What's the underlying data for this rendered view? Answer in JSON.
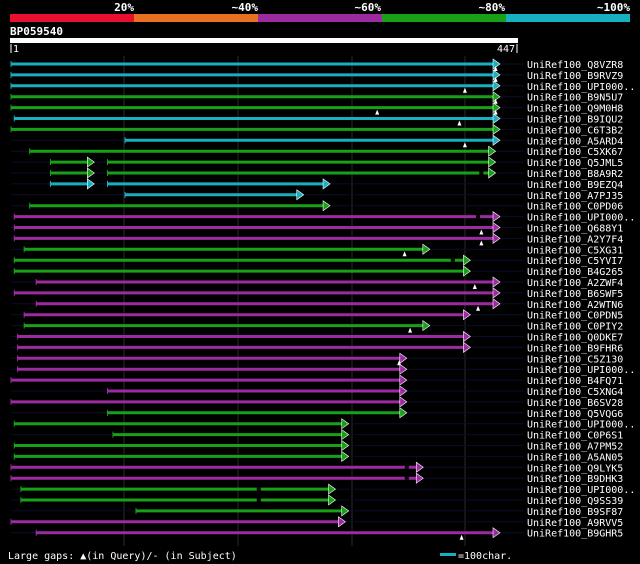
{
  "header": {
    "scale_labels": [
      "20%",
      "~40%",
      "~60%",
      "~80%",
      "~100%"
    ],
    "scale_colors": [
      "#e8102c",
      "#e87020",
      "#9c2aa0",
      "#18a018",
      "#18b0c0"
    ],
    "query_name": "BP059540",
    "ruler_start": "1",
    "ruler_end": "447"
  },
  "footer": {
    "gaps_label": "Large gaps: ▲(in Query)/- (in Subject)",
    "legend_label": "=100char.",
    "legend_color": "#18b0c0"
  },
  "query_length": 447,
  "hits": [
    {
      "name": "UniRef100_Q8VZR8",
      "color": "#18b0c0",
      "segments": [
        [
          1,
          447
        ]
      ],
      "gapsQ": [
        443
      ],
      "gapsS": []
    },
    {
      "name": "UniRef100_B9RVZ9",
      "color": "#18b0c0",
      "segments": [
        [
          1,
          447
        ]
      ],
      "gapsQ": [
        443
      ],
      "gapsS": []
    },
    {
      "name": "UniRef100_UPI000..",
      "color": "#18b0c0",
      "segments": [
        [
          1,
          447
        ]
      ],
      "gapsQ": [
        415
      ],
      "gapsS": []
    },
    {
      "name": "UniRef100_B9N5U7",
      "color": "#18a018",
      "segments": [
        [
          1,
          447
        ]
      ],
      "gapsQ": [
        443
      ],
      "gapsS": []
    },
    {
      "name": "UniRef100_Q9M0H8",
      "color": "#18a018",
      "segments": [
        [
          1,
          447
        ]
      ],
      "gapsQ": [
        335,
        443
      ],
      "gapsS": []
    },
    {
      "name": "UniRef100_B9IQU2",
      "color": "#18b0c0",
      "segments": [
        [
          4,
          447
        ]
      ],
      "gapsQ": [
        410
      ],
      "gapsS": []
    },
    {
      "name": "UniRef100_C6T3B2",
      "color": "#18a018",
      "segments": [
        [
          1,
          447
        ]
      ],
      "gapsQ": [],
      "gapsS": []
    },
    {
      "name": "UniRef100_A5ARD4",
      "color": "#18b0c0",
      "segments": [
        [
          105,
          447
        ]
      ],
      "gapsQ": [
        415
      ],
      "gapsS": []
    },
    {
      "name": "UniRef100_C5XK67",
      "color": "#18a018",
      "segments": [
        [
          18,
          443
        ]
      ],
      "gapsQ": [],
      "gapsS": []
    },
    {
      "name": "UniRef100_Q5JML5",
      "color": "#18a018",
      "segments": [
        [
          37,
          77
        ],
        [
          89,
          443
        ]
      ],
      "gapsQ": [],
      "gapsS": []
    },
    {
      "name": "UniRef100_B8A9R2",
      "color": "#18a018",
      "segments": [
        [
          37,
          77
        ],
        [
          89,
          443
        ]
      ],
      "gapsQ": [],
      "gapsS": [
        430
      ]
    },
    {
      "name": "UniRef100_B9EZQ4",
      "color": "#18b0c0",
      "segments": [
        [
          37,
          77
        ],
        [
          89,
          292
        ]
      ],
      "gapsQ": [],
      "gapsS": []
    },
    {
      "name": "UniRef100_A7PJ35",
      "color": "#18b0c0",
      "segments": [
        [
          105,
          268
        ]
      ],
      "gapsQ": [],
      "gapsS": []
    },
    {
      "name": "UniRef100_C0PD06",
      "color": "#18a018",
      "segments": [
        [
          18,
          292
        ]
      ],
      "gapsQ": [],
      "gapsS": []
    },
    {
      "name": "UniRef100_UPI000..",
      "color": "#9c2aa0",
      "segments": [
        [
          4,
          447
        ]
      ],
      "gapsQ": [],
      "gapsS": [
        427
      ]
    },
    {
      "name": "UniRef100_Q688Y1",
      "color": "#9c2aa0",
      "segments": [
        [
          4,
          447
        ]
      ],
      "gapsQ": [
        430
      ],
      "gapsS": []
    },
    {
      "name": "UniRef100_A2Y7F4",
      "color": "#9c2aa0",
      "segments": [
        [
          4,
          447
        ]
      ],
      "gapsQ": [
        430
      ],
      "gapsS": []
    },
    {
      "name": "UniRef100_C5XG31",
      "color": "#18a018",
      "segments": [
        [
          13,
          383
        ]
      ],
      "gapsQ": [
        360
      ],
      "gapsS": []
    },
    {
      "name": "UniRef100_C5YVI7",
      "color": "#18a018",
      "segments": [
        [
          4,
          420
        ]
      ],
      "gapsQ": [],
      "gapsS": [
        404
      ]
    },
    {
      "name": "UniRef100_B4G265",
      "color": "#18a018",
      "segments": [
        [
          4,
          420
        ]
      ],
      "gapsQ": [],
      "gapsS": []
    },
    {
      "name": "UniRef100_A2ZWF4",
      "color": "#9c2aa0",
      "segments": [
        [
          24,
          447
        ]
      ],
      "gapsQ": [
        424
      ],
      "gapsS": []
    },
    {
      "name": "UniRef100_B6SWF5",
      "color": "#9c2aa0",
      "segments": [
        [
          4,
          447
        ]
      ],
      "gapsQ": [],
      "gapsS": []
    },
    {
      "name": "UniRef100_A2WTN6",
      "color": "#9c2aa0",
      "segments": [
        [
          24,
          447
        ]
      ],
      "gapsQ": [
        427
      ],
      "gapsS": []
    },
    {
      "name": "UniRef100_C0PDN5",
      "color": "#9c2aa0",
      "segments": [
        [
          13,
          420
        ]
      ],
      "gapsQ": [],
      "gapsS": []
    },
    {
      "name": "UniRef100_C0PIY2",
      "color": "#18a018",
      "segments": [
        [
          13,
          383
        ]
      ],
      "gapsQ": [
        365
      ],
      "gapsS": []
    },
    {
      "name": "UniRef100_Q0DKE7",
      "color": "#9c2aa0",
      "segments": [
        [
          7,
          420
        ]
      ],
      "gapsQ": [],
      "gapsS": []
    },
    {
      "name": "UniRef100_B9FHR6",
      "color": "#9c2aa0",
      "segments": [
        [
          7,
          420
        ]
      ],
      "gapsQ": [],
      "gapsS": []
    },
    {
      "name": "UniRef100_C5Z130",
      "color": "#9c2aa0",
      "segments": [
        [
          7,
          362
        ]
      ],
      "gapsQ": [
        355
      ],
      "gapsS": []
    },
    {
      "name": "UniRef100_UPI000..",
      "color": "#9c2aa0",
      "segments": [
        [
          7,
          362
        ]
      ],
      "gapsQ": [],
      "gapsS": []
    },
    {
      "name": "UniRef100_B4FQ71",
      "color": "#9c2aa0",
      "segments": [
        [
          1,
          362
        ]
      ],
      "gapsQ": [],
      "gapsS": []
    },
    {
      "name": "UniRef100_C5XNG4",
      "color": "#9c2aa0",
      "segments": [
        [
          89,
          362
        ]
      ],
      "gapsQ": [],
      "gapsS": []
    },
    {
      "name": "UniRef100_B6SV28",
      "color": "#9c2aa0",
      "segments": [
        [
          1,
          362
        ]
      ],
      "gapsQ": [],
      "gapsS": []
    },
    {
      "name": "UniRef100_Q5VQG6",
      "color": "#18a018",
      "segments": [
        [
          89,
          362
        ]
      ],
      "gapsQ": [],
      "gapsS": []
    },
    {
      "name": "UniRef100_UPI000..",
      "color": "#18a018",
      "segments": [
        [
          4,
          309
        ]
      ],
      "gapsQ": [],
      "gapsS": []
    },
    {
      "name": "UniRef100_C0P6S1",
      "color": "#18a018",
      "segments": [
        [
          94,
          309
        ]
      ],
      "gapsQ": [],
      "gapsS": []
    },
    {
      "name": "UniRef100_A7PM52",
      "color": "#18a018",
      "segments": [
        [
          4,
          309
        ]
      ],
      "gapsQ": [],
      "gapsS": []
    },
    {
      "name": "UniRef100_A5AN05",
      "color": "#18a018",
      "segments": [
        [
          4,
          309
        ]
      ],
      "gapsQ": [],
      "gapsS": []
    },
    {
      "name": "UniRef100_Q9LYK5",
      "color": "#9c2aa0",
      "segments": [
        [
          1,
          377
        ]
      ],
      "gapsQ": [],
      "gapsS": [
        362
      ]
    },
    {
      "name": "UniRef100_B9DHK3",
      "color": "#9c2aa0",
      "segments": [
        [
          1,
          377
        ]
      ],
      "gapsQ": [],
      "gapsS": [
        362
      ]
    },
    {
      "name": "UniRef100_UPI000..",
      "color": "#18a018",
      "segments": [
        [
          10,
          297
        ]
      ],
      "gapsQ": [],
      "gapsS": [
        227
      ]
    },
    {
      "name": "UniRef100_Q9SS39",
      "color": "#18a018",
      "segments": [
        [
          10,
          297
        ]
      ],
      "gapsQ": [],
      "gapsS": [
        227
      ]
    },
    {
      "name": "UniRef100_B9SF87",
      "color": "#18a018",
      "segments": [
        [
          115,
          309
        ]
      ],
      "gapsQ": [],
      "gapsS": []
    },
    {
      "name": "UniRef100_A9RVV5",
      "color": "#9c2aa0",
      "segments": [
        [
          1,
          306
        ]
      ],
      "gapsQ": [],
      "gapsS": []
    },
    {
      "name": "UniRef100_B9GHR5",
      "color": "#9c2aa0",
      "segments": [
        [
          24,
          447
        ]
      ],
      "gapsQ": [
        412
      ],
      "gapsS": []
    }
  ]
}
